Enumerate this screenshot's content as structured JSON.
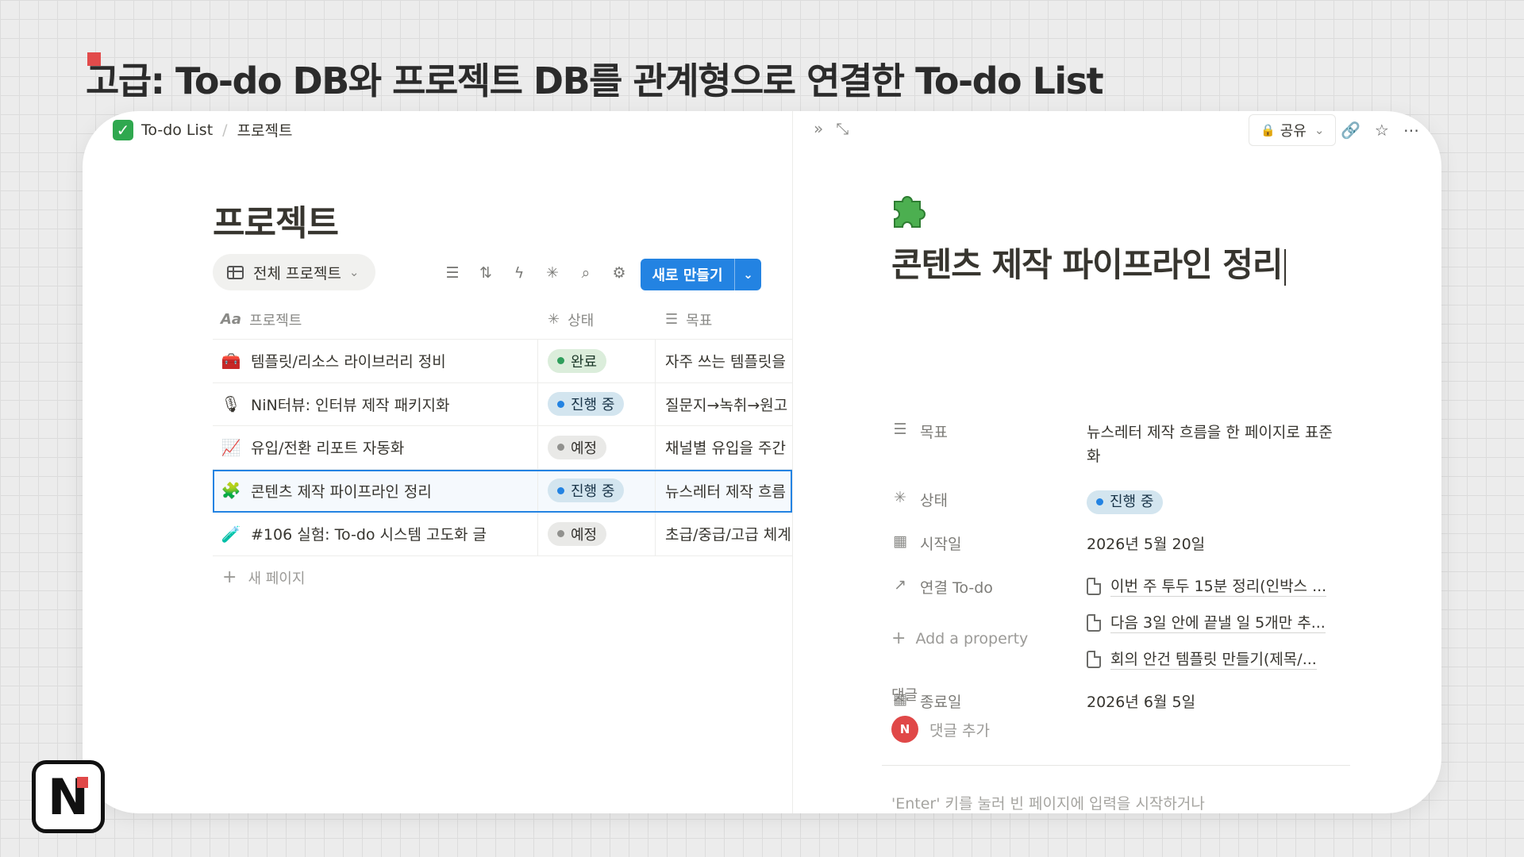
{
  "slide": {
    "title": "고급: To-do DB와 프로젝트 DB를 관계형으로 연결한 To-do List"
  },
  "breadcrumb": {
    "root": "To-do List",
    "current": "프로젝트"
  },
  "database": {
    "title": "프로젝트",
    "view_tab": "전체 프로젝트",
    "new_button": "새로 만들기",
    "columns": [
      {
        "label": "프로젝트",
        "icon": "Aa"
      },
      {
        "label": "상태",
        "icon": "status-icon"
      },
      {
        "label": "목표",
        "icon": "text-icon"
      }
    ],
    "rows": [
      {
        "icon": "toolbox-icon",
        "name": "템플릿/리소스 라이브러리 정비",
        "status": "완료",
        "goal": "자주 쓰는 템플릿을"
      },
      {
        "icon": "microphone-icon",
        "name": "NiN터뷰: 인터뷰 제작 패키지화",
        "status": "진행 중",
        "goal": "질문지→녹취→원고"
      },
      {
        "icon": "chart-up-icon",
        "name": "유입/전환 리포트 자동화",
        "status": "예정",
        "goal": "채널별 유입을 주간"
      },
      {
        "icon": "puzzle-icon",
        "name": "콘텐츠 제작 파이프라인 정리",
        "status": "진행 중",
        "goal": "뉴스레터 제작 흐름"
      },
      {
        "icon": "test-tube-icon",
        "name": "#106 실험: To-do 시스템 고도화 글",
        "status": "예정",
        "goal": "초급/중급/고급 체계"
      }
    ],
    "new_page": "새 페이지"
  },
  "page": {
    "share_label": "공유",
    "title": "콘텐츠 제작 파이프라인 정리",
    "properties": {
      "goal_label": "목표",
      "goal_value": "뉴스레터 제작 흐름을 한 페이지로 표준화",
      "status_label": "상태",
      "status_value": "진행 중",
      "start_label": "시작일",
      "start_value": "2026년 5월 20일",
      "relation_label": "연결 To-do",
      "relations": [
        "이번 주 투두 15분 정리(인박스 ...",
        "다음 3일 안에 끝낼 일 5개만 추...",
        "회의 안건 템플릿 만들기(제목/..."
      ],
      "end_label": "종료일",
      "end_value": "2026년 6월 5일"
    },
    "add_property": "Add a property",
    "comments_heading": "댓글",
    "comment_placeholder": "댓글 추가",
    "avatar_initial": "N",
    "editor_hint": "'Enter' 키를 눌러 빈 페이지에 입력을 시작하거나"
  },
  "colors": {
    "accent": "#2383e2",
    "brand_red": "#e04848",
    "done": "#2e9e5b"
  },
  "logo": {
    "letter": "N"
  }
}
